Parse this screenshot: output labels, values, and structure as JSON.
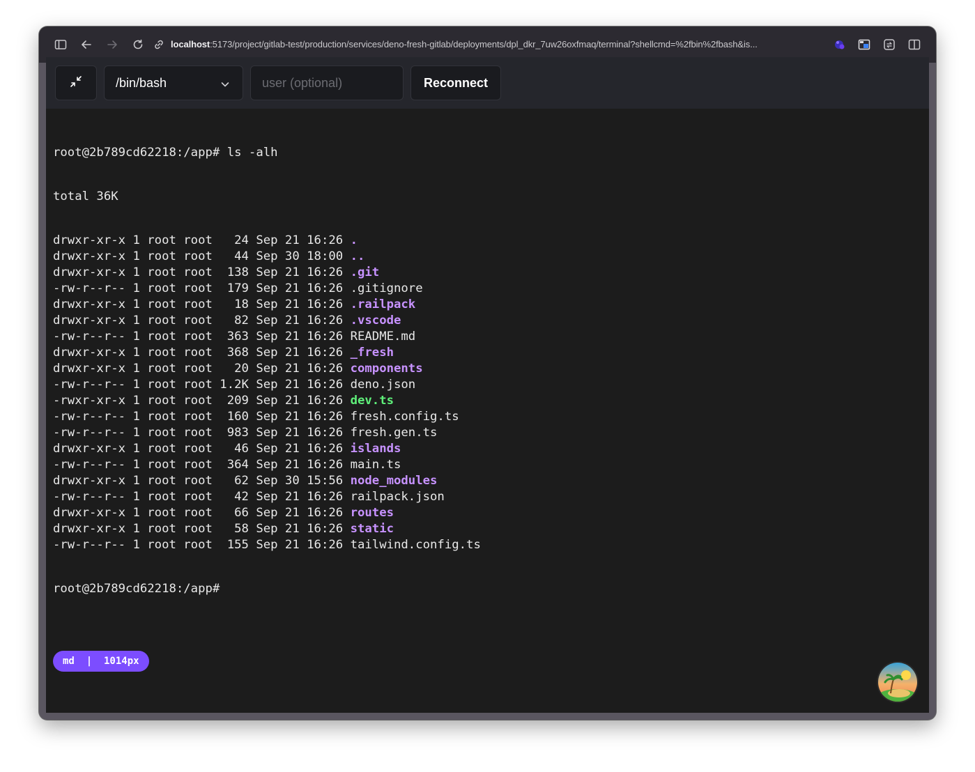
{
  "browser": {
    "url_host": "localhost",
    "url_rest": ":5173/project/gitlab-test/production/services/deno-fresh-gitlab/deployments/dpl_dkr_7uw26oxfmaq/terminal?shellcmd=%2fbin%2fbash&is..."
  },
  "toolbar": {
    "shell_value": "/bin/bash",
    "user_placeholder": "user (optional)",
    "user_value": "",
    "reconnect_label": "Reconnect"
  },
  "terminal": {
    "prompt_command": "root@2b789cd62218:/app# ls -alh",
    "total": "total 36K",
    "entries": [
      {
        "meta": "drwxr-xr-x 1 root root   24 Sep 21 16:26 ",
        "name": ".",
        "kind": "dir"
      },
      {
        "meta": "drwxr-xr-x 1 root root   44 Sep 30 18:00 ",
        "name": "..",
        "kind": "dir"
      },
      {
        "meta": "drwxr-xr-x 1 root root  138 Sep 21 16:26 ",
        "name": ".git",
        "kind": "dir"
      },
      {
        "meta": "-rw-r--r-- 1 root root  179 Sep 21 16:26 ",
        "name": ".gitignore",
        "kind": "file"
      },
      {
        "meta": "drwxr-xr-x 1 root root   18 Sep 21 16:26 ",
        "name": ".railpack",
        "kind": "dir"
      },
      {
        "meta": "drwxr-xr-x 1 root root   82 Sep 21 16:26 ",
        "name": ".vscode",
        "kind": "dir"
      },
      {
        "meta": "-rw-r--r-- 1 root root  363 Sep 21 16:26 ",
        "name": "README.md",
        "kind": "file"
      },
      {
        "meta": "drwxr-xr-x 1 root root  368 Sep 21 16:26 ",
        "name": "_fresh",
        "kind": "dir"
      },
      {
        "meta": "drwxr-xr-x 1 root root   20 Sep 21 16:26 ",
        "name": "components",
        "kind": "dir"
      },
      {
        "meta": "-rw-r--r-- 1 root root 1.2K Sep 21 16:26 ",
        "name": "deno.json",
        "kind": "file"
      },
      {
        "meta": "-rwxr-xr-x 1 root root  209 Sep 21 16:26 ",
        "name": "dev.ts",
        "kind": "exec"
      },
      {
        "meta": "-rw-r--r-- 1 root root  160 Sep 21 16:26 ",
        "name": "fresh.config.ts",
        "kind": "file"
      },
      {
        "meta": "-rw-r--r-- 1 root root  983 Sep 21 16:26 ",
        "name": "fresh.gen.ts",
        "kind": "file"
      },
      {
        "meta": "drwxr-xr-x 1 root root   46 Sep 21 16:26 ",
        "name": "islands",
        "kind": "dir"
      },
      {
        "meta": "-rw-r--r-- 1 root root  364 Sep 21 16:26 ",
        "name": "main.ts",
        "kind": "file"
      },
      {
        "meta": "drwxr-xr-x 1 root root   62 Sep 30 15:56 ",
        "name": "node_modules",
        "kind": "dir"
      },
      {
        "meta": "-rw-r--r-- 1 root root   42 Sep 21 16:26 ",
        "name": "railpack.json",
        "kind": "file"
      },
      {
        "meta": "drwxr-xr-x 1 root root   66 Sep 21 16:26 ",
        "name": "routes",
        "kind": "dir"
      },
      {
        "meta": "drwxr-xr-x 1 root root   58 Sep 21 16:26 ",
        "name": "static",
        "kind": "dir"
      },
      {
        "meta": "-rw-r--r-- 1 root root  155 Sep 21 16:26 ",
        "name": "tailwind.config.ts",
        "kind": "file"
      }
    ],
    "final_prompt": "root@2b789cd62218:/app#"
  },
  "badge": {
    "text": "md  |  1014px"
  },
  "icons": {
    "sidebar": "sidebar-toggle-icon",
    "back": "back-arrow-icon",
    "forward": "forward-arrow-icon",
    "reload": "reload-icon",
    "link": "link-icon",
    "ext1": "extension-icon",
    "ext2": "picture-in-picture-icon",
    "ext3": "extension-puzzle-icon",
    "split": "split-view-icon",
    "minimize": "minimize-arrows-icon",
    "chevron": "chevron-down-icon"
  },
  "colors": {
    "dir": "#c792ff",
    "exec": "#5ff07a",
    "badge": "#7c4dff",
    "terminal_bg": "#1c1c1c"
  }
}
